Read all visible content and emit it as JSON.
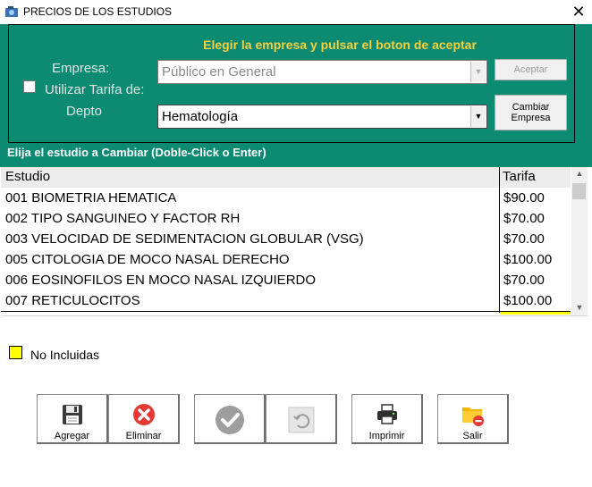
{
  "window": {
    "title": "PRECIOS DE LOS ESTUDIOS",
    "close_glyph": "✕"
  },
  "panel": {
    "heading": "Elegir la empresa y pulsar el boton de aceptar",
    "empresa_label": "Empresa:",
    "utilizar_label": "Utilizar Tarifa de:",
    "depto_label": "Depto",
    "empresa_combo_value": "Público en General",
    "depto_combo_value": "Hematología",
    "aceptar_label": "Aceptar",
    "cambiar_label_1": "Cambiar",
    "cambiar_label_2": "Empresa",
    "utilizar_checked": false
  },
  "instruction": "Elija el estudio a Cambiar (Doble-Click o Enter)",
  "grid": {
    "columns": [
      "Estudio",
      "Tarifa"
    ],
    "rows": [
      [
        "001 BIOMETRIA HEMATICA",
        "$90.00"
      ],
      [
        "002 TIPO SANGUINEO Y FACTOR RH",
        "$70.00"
      ],
      [
        "003 VELOCIDAD DE SEDIMENTACION GLOBULAR (VSG)",
        "$70.00"
      ],
      [
        "005 CITOLOGIA DE MOCO NASAL DERECHO",
        "$100.00"
      ],
      [
        "006 EOSINOFILOS EN MOCO NASAL IZQUIERDO",
        "$70.00"
      ],
      [
        "007 RETICULOCITOS",
        "$100.00"
      ]
    ]
  },
  "legend": {
    "label": "No Incluidas",
    "color": "#ffff00"
  },
  "toolbar": {
    "agregar": "Agregar",
    "eliminar": "Eliminar",
    "imprimir": "Imprimir",
    "salir": "Salir"
  },
  "colors": {
    "teal": "#0d8a72",
    "heading": "#f4d03f",
    "delete_red": "#e53935"
  },
  "icons": [
    "app-icon",
    "close-icon",
    "chevron-down-icon",
    "save-icon",
    "delete-icon",
    "check-icon",
    "undo-icon",
    "printer-icon",
    "exit-folder-icon"
  ]
}
